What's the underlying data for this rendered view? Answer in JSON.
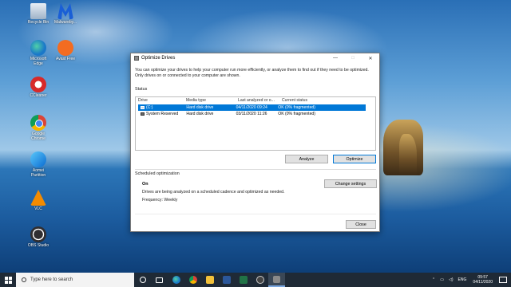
{
  "desktop": {
    "icons": [
      {
        "label": "Recycle Bin"
      },
      {
        "label": "Malwareby..."
      },
      {
        "label": "Microsoft Edge"
      },
      {
        "label": "Avast Free"
      },
      {
        "label": "CCleaner"
      },
      {
        "label": "Google Chrome"
      },
      {
        "label": "Aomei Partition"
      },
      {
        "label": "VLC"
      },
      {
        "label": "OBS Studio"
      }
    ]
  },
  "dialog": {
    "title": "Optimize Drives",
    "controls": {
      "minimize": "—",
      "maximize": "□",
      "close": "✕"
    },
    "intro": "You can optimize your drives to help your computer run more efficiently, or analyze them to find out if they need to be optimized. Only drives on or connected to your computer are shown.",
    "status_label": "Status",
    "columns": [
      "Drive",
      "Media type",
      "Last analyzed or o...",
      "Current status"
    ],
    "drives": [
      {
        "drive": "(C:)",
        "media": "Hard disk drive",
        "last": "04/11/2020 09:24",
        "status": "OK (0% fragmented)",
        "selected": true
      },
      {
        "drive": "System Reserved",
        "media": "Hard disk drive",
        "last": "03/11/2020 11:26",
        "status": "OK (0% fragmented)",
        "selected": false
      }
    ],
    "analyze_label": "Analyze",
    "optimize_label": "Optimize",
    "scheduled_label": "Scheduled optimization",
    "sched_state": "On",
    "sched_desc": "Drives are being analyzed on a scheduled cadence and optimized as needed.",
    "sched_freq": "Frequency: Weekly",
    "change_settings_label": "Change settings",
    "close_label": "Close"
  },
  "taskbar": {
    "search_placeholder": "Type here to search",
    "language": "ENG",
    "time": "09:57",
    "date": "04/11/2020"
  }
}
